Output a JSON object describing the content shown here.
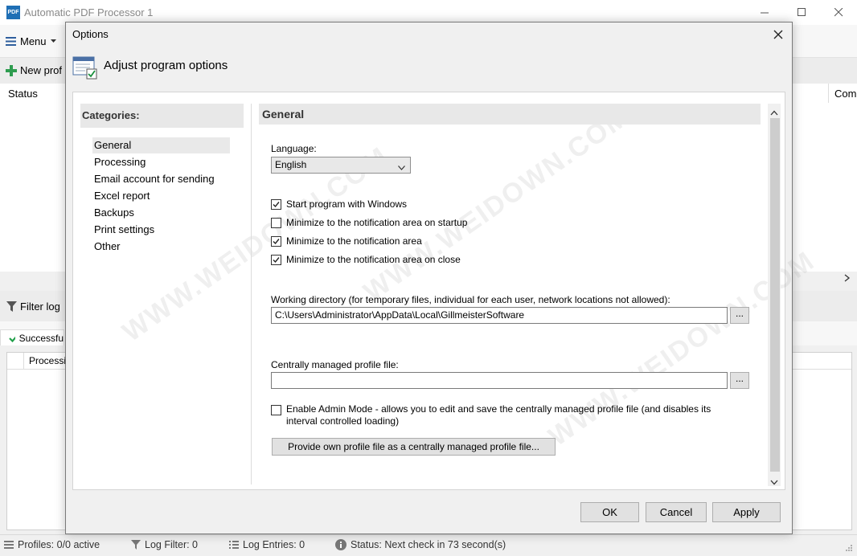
{
  "main": {
    "title": "Automatic PDF Processor 1",
    "logo_text": "PDF",
    "menu_label": "Menu",
    "new_profile_label": "New prof",
    "status_col": "Status",
    "right_col": "Com",
    "filter_log_label": "Filter log",
    "log_tab_label": "Successfu",
    "log_col": "Processin"
  },
  "statusbar": {
    "profiles": "Profiles: 0/0 active",
    "log_filter": "Log Filter: 0",
    "log_entries": "Log Entries: 0",
    "status": "Status: Next check in 73 second(s)"
  },
  "dialog": {
    "title": "Options",
    "header": "Adjust program options",
    "categories_label": "Categories:",
    "categories": [
      "General",
      "Processing",
      "Email account for sending",
      "Excel report",
      "Backups",
      "Print settings",
      "Other"
    ],
    "selected_category": "General",
    "section_title": "General",
    "language_label": "Language:",
    "language_value": "English",
    "checkboxes": [
      {
        "label": "Start program with Windows",
        "checked": true
      },
      {
        "label": "Minimize to the notification area on startup",
        "checked": false
      },
      {
        "label": "Minimize to the notification area",
        "checked": true
      },
      {
        "label": "Minimize to the notification area on close",
        "checked": true
      }
    ],
    "working_dir_label": "Working directory (for temporary files, individual for each user, network locations not allowed):",
    "working_dir_value": "C:\\Users\\Administrator\\AppData\\Local\\GillmeisterSoftware",
    "browse_label": "...",
    "central_profile_label": "Centrally managed profile file:",
    "central_profile_value": "",
    "admin_mode_label_line1": "Enable Admin Mode - allows you to edit and save the centrally managed profile file (and disables its",
    "admin_mode_label_line2": "interval controlled loading)",
    "admin_mode_checked": false,
    "provide_profile_button": "Provide own profile file as a centrally managed profile file...",
    "ok_button": "OK",
    "cancel_button": "Cancel",
    "apply_button": "Apply"
  },
  "watermark": "WWW.WEIDOWN.COM",
  "colors": {
    "accent_green": "#2e9c4f",
    "logo_blue": "#1f6fb5",
    "check_green": "#22a04b"
  }
}
